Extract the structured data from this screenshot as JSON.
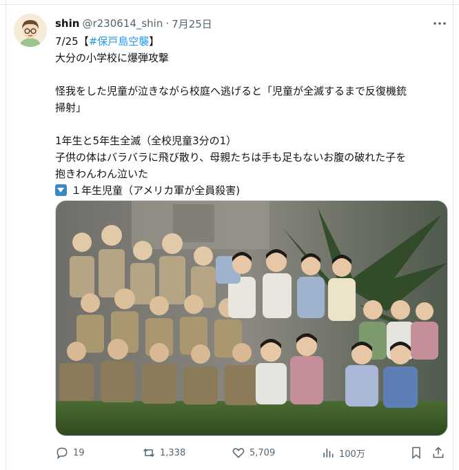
{
  "post": {
    "author_name": "shin",
    "handle": "@r230614_shin",
    "separator": "·",
    "date": "7月25日",
    "lines": {
      "l1_date": "7/25",
      "l1_open": "【",
      "l1_hashtag": "#保戸島空襲",
      "l1_close": "】",
      "l2": "大分の小学校に爆弾攻撃",
      "l3": "怪我をした児童が泣きながら校庭へ逃げると「児童が全滅するまで反復機銃",
      "l4": "掃射」",
      "l5": "1年生と5年生全滅（全校児童3分の1）",
      "l6": "子供の体はバラバラに飛び散り、母親たちは手も足もないお腹の破れた子を",
      "l7": "抱きわんわん泣いた",
      "l8": "１年生児童（アメリカ軍が全員殺害)"
    }
  },
  "actions": {
    "replies": "19",
    "reposts": "1,338",
    "likes": "5,709",
    "views": "100万"
  },
  "icons": {
    "avatar": "cartoon-avatar-icon",
    "more": "more-dots-icon",
    "down_arrow": "down-arrow-keycap-icon",
    "reply": "reply-icon",
    "repost": "repost-icon",
    "like": "heart-icon",
    "views": "bar-chart-icon",
    "bookmark": "bookmark-icon",
    "share": "share-icon"
  },
  "colors": {
    "text": "#0f1419",
    "muted": "#536471",
    "link": "#1d9bf0",
    "border": "#cfd9de"
  }
}
